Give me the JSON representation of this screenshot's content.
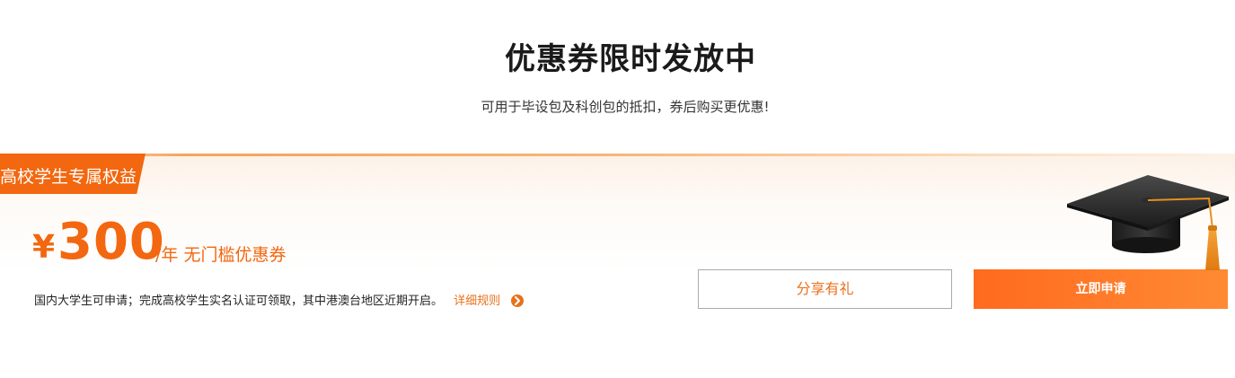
{
  "header": {
    "title": "优惠券限时发放中",
    "subtitle": "可用于毕设包及科创包的抵扣，券后购买更优惠!"
  },
  "offer": {
    "badge": "高校学生专属权益",
    "currency": "¥",
    "amount": "300",
    "unit": "/年 无门槛优惠券",
    "description": "国内大学生可申请；完成高校学生实名认证可领取，其中港澳台地区近期开启。",
    "rules_link": "详细规则",
    "icons": [
      "arrow-right-icon",
      "graduation-cap-icon"
    ]
  },
  "actions": {
    "share_label": "分享有礼",
    "apply_label": "立即申请"
  },
  "colors": {
    "accent": "#f2670f",
    "link": "#e8711c",
    "apply_gradient_start": "#ff6a1f",
    "apply_gradient_end": "#ff8a34"
  }
}
